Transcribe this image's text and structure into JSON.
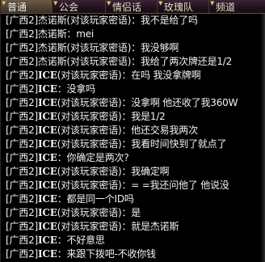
{
  "tabs": [
    {
      "label": "普通",
      "active": true
    },
    {
      "label": "公会",
      "active": false
    },
    {
      "label": "情侣话",
      "active": false
    },
    {
      "label": "玫瑰队",
      "active": false
    },
    {
      "label": "频道",
      "active": false
    }
  ],
  "messages": [
    {
      "channel": "[广西2]",
      "speaker": "杰诺斯",
      "bold": false,
      "text": "(对该玩家密语)：我不是给了吗"
    },
    {
      "channel": "[广西2]",
      "speaker": "杰诺斯",
      "bold": false,
      "text": "：mei"
    },
    {
      "channel": "[广西2]",
      "speaker": "杰诺斯",
      "bold": false,
      "text": "(对该玩家密语)：我没够啊"
    },
    {
      "channel": "[广西2]",
      "speaker": "杰诺斯",
      "bold": false,
      "text": "(对该玩家密语)：我给了两次牌还是1/2"
    },
    {
      "channel": "[广西2]",
      "speaker": "ICE",
      "bold": true,
      "text": "(对该玩家密语)：在吗 我没拿牌啊"
    },
    {
      "channel": "[广西2]",
      "speaker": "ICE",
      "bold": true,
      "text": "：没拿吗"
    },
    {
      "channel": "[广西2]",
      "speaker": "ICE",
      "bold": true,
      "text": "(对该玩家密语)：没拿啊 他还收了我360W"
    },
    {
      "channel": "[广西2]",
      "speaker": "ICE",
      "bold": true,
      "text": "(对该玩家密语)：我是1/2"
    },
    {
      "channel": "[广西2]",
      "speaker": "ICE",
      "bold": true,
      "text": "(对该玩家密语)：他还交易我两次"
    },
    {
      "channel": "[广西2]",
      "speaker": "ICE",
      "bold": true,
      "text": "(对该玩家密语)：我看时间快到了就点了"
    },
    {
      "channel": "[广西2]",
      "speaker": "ICE",
      "bold": true,
      "text": "：你确定是两次?"
    },
    {
      "channel": "[广西2]",
      "speaker": "ICE",
      "bold": true,
      "text": "(对该玩家密语)：我确定啊"
    },
    {
      "channel": "[广西2]",
      "speaker": "ICE",
      "bold": true,
      "text": "(对该玩家密语)：= =我还问他了 他说没"
    },
    {
      "channel": "[广西2]",
      "speaker": "ICE",
      "bold": true,
      "text": "：都是同一个ID吗"
    },
    {
      "channel": "[广西2]",
      "speaker": "ICE",
      "bold": true,
      "text": "(对该玩家密语)：是"
    },
    {
      "channel": "[广西2]",
      "speaker": "ICE",
      "bold": true,
      "text": "(对该玩家密语)：就是杰诺斯"
    },
    {
      "channel": "[广西2]",
      "speaker": "ICE",
      "bold": true,
      "text": "：不好意思"
    },
    {
      "channel": "[广西2]",
      "speaker": "ICE",
      "bold": true,
      "text": "：来跟下拨吧-不收你钱"
    }
  ],
  "colors": {
    "background": "#000000",
    "text": "#f2f2f2",
    "tab_text": "#e9e2c9",
    "tab_arrow": "#e0c070"
  }
}
